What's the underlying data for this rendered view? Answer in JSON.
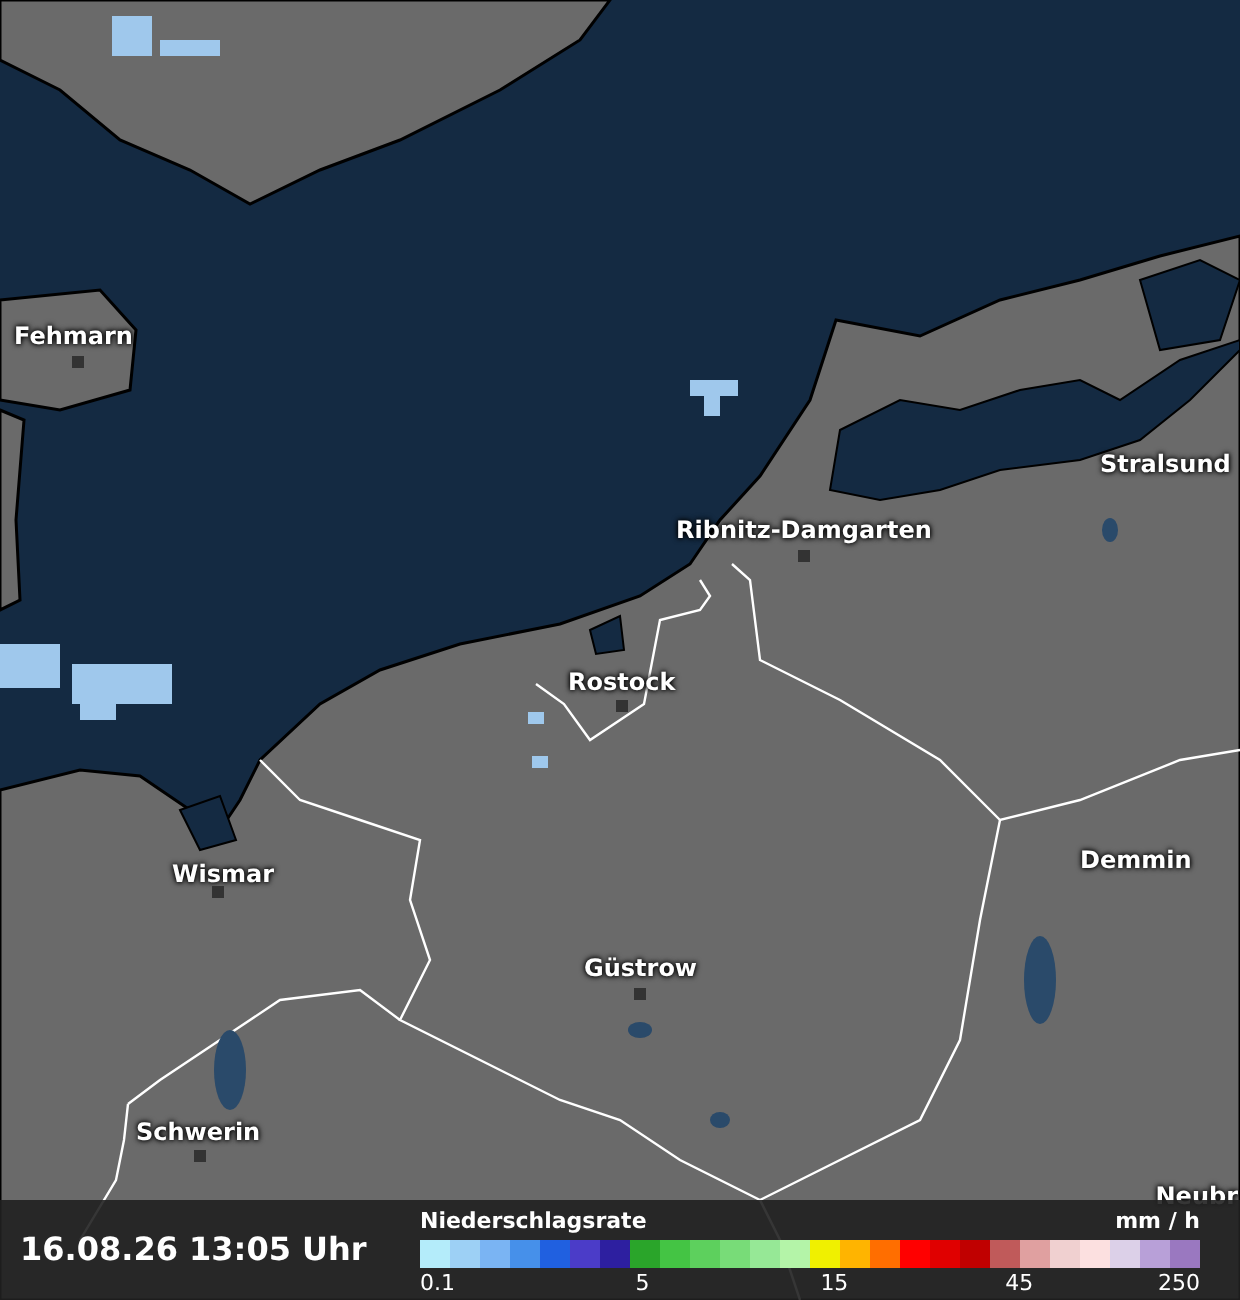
{
  "map": {
    "places": [
      {
        "name": "Fehmarn",
        "dot": true
      },
      {
        "name": "Ribnitz-Damgarten",
        "dot": true
      },
      {
        "name": "Stralsund",
        "dot": false
      },
      {
        "name": "Rostock",
        "dot": true
      },
      {
        "name": "Wismar",
        "dot": true
      },
      {
        "name": "Demmin",
        "dot": false
      },
      {
        "name": "Güstrow",
        "dot": true
      },
      {
        "name": "Schwerin",
        "dot": true
      },
      {
        "name": "Neubr",
        "dot": false
      }
    ]
  },
  "timestamp": "16.08.26 13:05 Uhr",
  "legend": {
    "title": "Niederschlagsrate",
    "unit": "mm / h",
    "end_tick": "250",
    "swatches": [
      {
        "color": "#b4ecfa",
        "tick": "0.1"
      },
      {
        "color": "#9dd0f5"
      },
      {
        "color": "#7ab4f3"
      },
      {
        "color": "#4690ea"
      },
      {
        "color": "#2060e0"
      },
      {
        "color": "#4b3cc8"
      },
      {
        "color": "#2d1fa0"
      },
      {
        "color": "#2aa52a",
        "tick": "5"
      },
      {
        "color": "#44c444"
      },
      {
        "color": "#5dd05d"
      },
      {
        "color": "#78dc78"
      },
      {
        "color": "#96e896"
      },
      {
        "color": "#b4f4a8"
      },
      {
        "color": "#f0f000",
        "tick": "15"
      },
      {
        "color": "#ffb400"
      },
      {
        "color": "#ff6e00"
      },
      {
        "color": "#ff0000"
      },
      {
        "color": "#e00000"
      },
      {
        "color": "#c00000"
      },
      {
        "color": "#c05a5a",
        "tick": "45"
      },
      {
        "color": "#e0a0a0"
      },
      {
        "color": "#f0d0d0"
      },
      {
        "color": "#fce0e0"
      },
      {
        "color": "#dcd0e8"
      },
      {
        "color": "#b8a0d8"
      },
      {
        "color": "#9a78c0"
      }
    ]
  }
}
